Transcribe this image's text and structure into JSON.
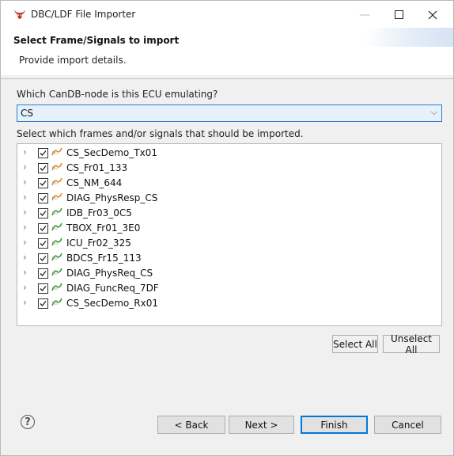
{
  "window": {
    "title": "DBC/LDF File Importer",
    "minimize_symbol": "—",
    "maximize_symbol": "☐",
    "close_symbol": "✕"
  },
  "banner": {
    "title": "Select Frame/Signals to import",
    "description": "Provide import details."
  },
  "node_question": "Which CanDB-node is this ECU emulating?",
  "node_combo": {
    "value": "CS",
    "arrow": "⌵"
  },
  "frames_label": "Select which frames and/or signals that should be imported.",
  "tree": {
    "items": [
      {
        "label": "CS_SecDemo_Tx01",
        "checked": true,
        "icon": "tx-frame-icon"
      },
      {
        "label": "CS_Fr01_133",
        "checked": true,
        "icon": "tx-frame-icon"
      },
      {
        "label": "CS_NM_644",
        "checked": true,
        "icon": "tx-frame-icon"
      },
      {
        "label": "DIAG_PhysResp_CS",
        "checked": true,
        "icon": "tx-frame-icon"
      },
      {
        "label": "IDB_Fr03_0C5",
        "checked": true,
        "icon": "rx-frame-icon"
      },
      {
        "label": "TBOX_Fr01_3E0",
        "checked": true,
        "icon": "rx-frame-icon"
      },
      {
        "label": "ICU_Fr02_325",
        "checked": true,
        "icon": "rx-frame-icon"
      },
      {
        "label": "BDCS_Fr15_113",
        "checked": true,
        "icon": "rx-frame-icon"
      },
      {
        "label": "DIAG_PhysReq_CS",
        "checked": true,
        "icon": "rx-frame-icon"
      },
      {
        "label": "DIAG_FuncReq_7DF",
        "checked": true,
        "icon": "rx-frame-icon"
      },
      {
        "label": "CS_SecDemo_Rx01",
        "checked": true,
        "icon": "rx-frame-icon"
      }
    ],
    "expander": "›"
  },
  "buttons": {
    "select_all": "Select All",
    "unselect_all": "Unselect All",
    "back": "< Back",
    "next": "Next >",
    "finish": "Finish",
    "cancel": "Cancel",
    "help": "?"
  },
  "colors": {
    "tx_icon": "#e8892b",
    "rx_icon": "#3f9a3a",
    "accent": "#0078d7"
  }
}
